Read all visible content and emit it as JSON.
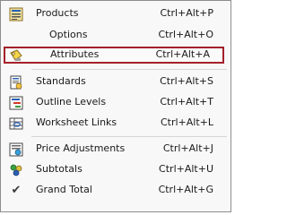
{
  "menu": {
    "items": [
      {
        "label": "Products",
        "shortcut": "Ctrl+Alt+P",
        "icon": "products-icon"
      },
      {
        "label": "Options",
        "shortcut": "Ctrl+Alt+O",
        "icon": ""
      },
      {
        "label": "Attributes",
        "shortcut": "Ctrl+Alt+A",
        "icon": "attributes-icon",
        "highlighted": true
      },
      {
        "label": "Standards",
        "shortcut": "Ctrl+Alt+S",
        "icon": "standards-icon"
      },
      {
        "label": "Outline Levels",
        "shortcut": "Ctrl+Alt+T",
        "icon": "outline-levels-icon"
      },
      {
        "label": "Worksheet Links",
        "shortcut": "Ctrl+Alt+L",
        "icon": "worksheet-links-icon"
      },
      {
        "label": "Price Adjustments",
        "shortcut": "Ctrl+Alt+J",
        "icon": "price-adjustments-icon"
      },
      {
        "label": "Subtotals",
        "shortcut": "Ctrl+Alt+U",
        "icon": "subtotals-icon"
      },
      {
        "label": "Grand Total",
        "shortcut": "Ctrl+Alt+G",
        "icon": "check-icon",
        "checked": true
      }
    ]
  },
  "colors": {
    "highlight_border": "#a4202a",
    "menu_border": "#8d8d8d",
    "background": "#f8f8f8"
  }
}
